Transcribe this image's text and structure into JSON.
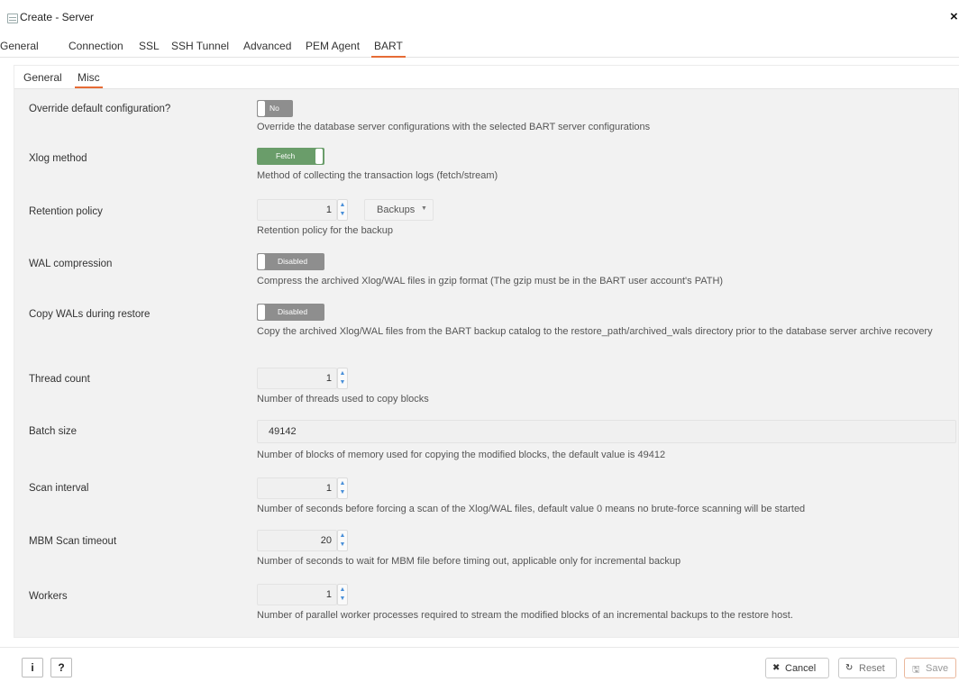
{
  "window": {
    "title": "Create - Server",
    "close_symbol": "×"
  },
  "top_tabs": [
    {
      "label": "General"
    },
    {
      "label": "Connection"
    },
    {
      "label": "SSL"
    },
    {
      "label": "SSH Tunnel"
    },
    {
      "label": "Advanced"
    },
    {
      "label": "PEM Agent"
    },
    {
      "label": "BART",
      "active": true
    }
  ],
  "sub_tabs": [
    {
      "label": "General"
    },
    {
      "label": "Misc",
      "active": true
    }
  ],
  "form": {
    "override": {
      "label": "Override default configuration?",
      "switch_text": "No",
      "help": "Override the database server configurations with the selected BART server configurations"
    },
    "xlog_method": {
      "label": "Xlog method",
      "switch_text": "Fetch",
      "help": "Method of collecting the transaction logs (fetch/stream)"
    },
    "retention_policy": {
      "label": "Retention policy",
      "value": "1",
      "unit": "Backups",
      "help": "Retention policy for the backup"
    },
    "wal_compression": {
      "label": "WAL compression",
      "switch_text": "Disabled",
      "help": "Compress the archived Xlog/WAL files in gzip format (The gzip must be in the BART user account's PATH)"
    },
    "copy_wals": {
      "label": "Copy WALs during restore",
      "switch_text": "Disabled",
      "help": "Copy the archived Xlog/WAL files from the BART backup catalog to the restore_path/archived_wals directory prior to the database server archive recovery"
    },
    "thread_count": {
      "label": "Thread count",
      "value": "1",
      "help": "Number of threads used to copy blocks"
    },
    "batch_size": {
      "label": "Batch size",
      "value": "49142",
      "help": "Number of blocks of memory used for copying the modified blocks, the default value is 49412"
    },
    "scan_interval": {
      "label": "Scan interval",
      "value": "1",
      "help": "Number of seconds before forcing a scan of the Xlog/WAL files, default value 0 means no brute-force scanning will be started"
    },
    "mbm_scan_timeout": {
      "label": "MBM Scan timeout",
      "value": "20",
      "help": "Number of seconds to wait for MBM file before timing out, applicable only for incremental backup"
    },
    "workers": {
      "label": "Workers",
      "value": "1",
      "help": "Number of parallel worker processes required to stream the modified blocks of an incremental backups to the restore host."
    }
  },
  "footer": {
    "info_label": "i",
    "help_label": "?",
    "cancel_label": "Cancel",
    "reset_label": "Reset",
    "save_label": "Save"
  },
  "colors": {
    "accent": "#e66b35",
    "switch_on": "#6a9d6a",
    "switch_off": "#8e8e8e",
    "spinner_arrow": "#4a90d9"
  }
}
